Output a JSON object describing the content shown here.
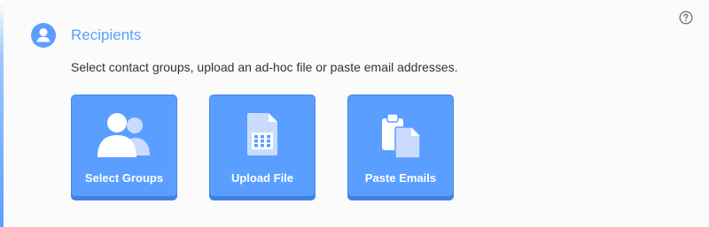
{
  "section": {
    "title": "Recipients",
    "description": "Select contact groups, upload an ad-hoc file or paste email addresses.",
    "icon": "user-circle-icon"
  },
  "help": {
    "icon": "question-circle-icon"
  },
  "tiles": [
    {
      "label": "Select Groups",
      "icon": "users-icon"
    },
    {
      "label": "Upload File",
      "icon": "spreadsheet-file-icon"
    },
    {
      "label": "Paste Emails",
      "icon": "clipboard-paste-icon"
    }
  ],
  "colors": {
    "accent": "#5aa0ff",
    "tile_bg": "#5a9fff",
    "tile_border": "#4587e6",
    "text": "#333333"
  }
}
